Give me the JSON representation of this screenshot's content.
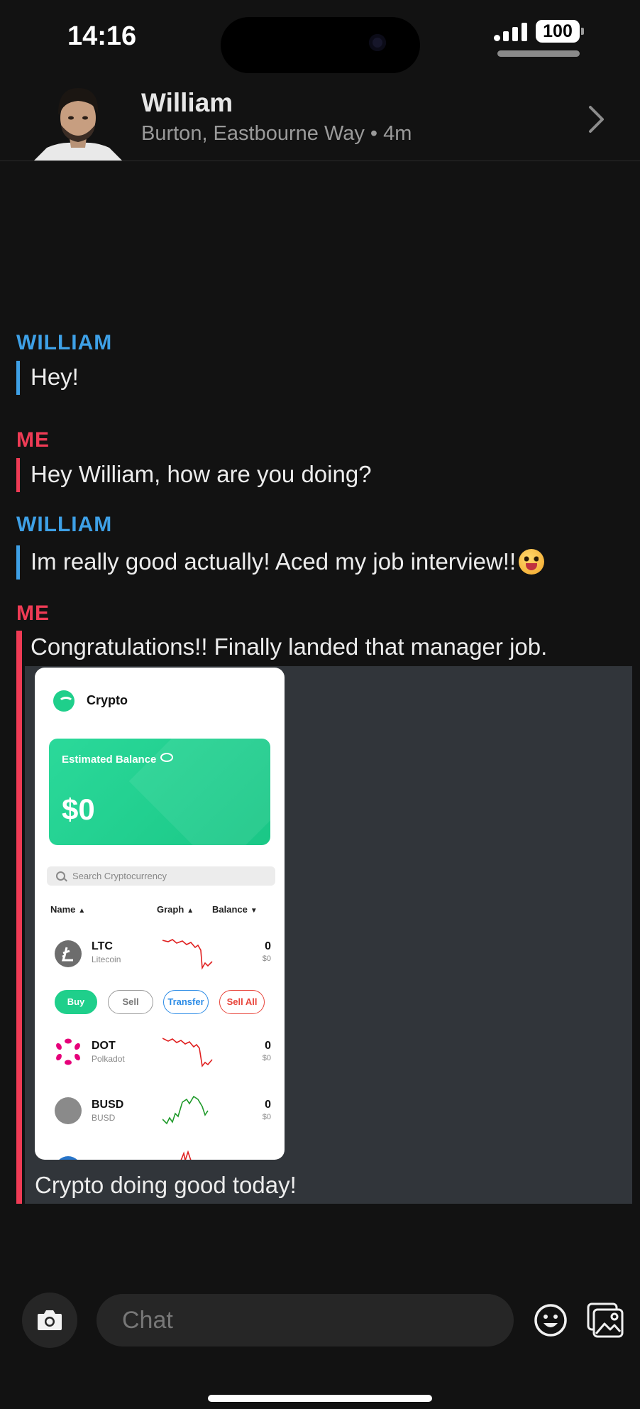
{
  "status_bar": {
    "time": "14:16",
    "battery": "100"
  },
  "contact": {
    "name": "William",
    "subtitle": "Burton, Eastbourne Way • 4m"
  },
  "messages": [
    {
      "sender": "WILLIAM",
      "text": "Hey!"
    },
    {
      "sender": "ME",
      "text": "Hey William, how are you doing?"
    },
    {
      "sender": "WILLIAM",
      "text": "Im really good actually! Aced my job interview!!"
    },
    {
      "sender": "ME",
      "text": "Congratulations!! Finally landed that manager job.",
      "attachment_caption": "Crypto doing good today!"
    }
  ],
  "attachment": {
    "app_title": "Crypto",
    "balance_label": "Estimated Balance",
    "balance_value": "$0",
    "search_placeholder": "Search Cryptocurrency",
    "columns": {
      "name": "Name",
      "graph": "Graph",
      "balance": "Balance"
    },
    "coins": [
      {
        "symbol": "LTC",
        "name": "Litecoin",
        "amount": "0",
        "usd": "$0",
        "color": "#6d6d6d",
        "trend": "down"
      },
      {
        "symbol": "DOT",
        "name": "Polkadot",
        "amount": "0",
        "usd": "$0",
        "color": "#e6007a",
        "trend": "down"
      },
      {
        "symbol": "BUSD",
        "name": "BUSD",
        "amount": "0",
        "usd": "$0",
        "color": "#8a8a8a",
        "trend": "up"
      }
    ],
    "actions": {
      "buy": "Buy",
      "sell": "Sell",
      "transfer": "Transfer",
      "sell_all": "Sell All"
    },
    "colors": {
      "accent": "#1fcf8b",
      "down": "#e02020",
      "up": "#1f9a2a",
      "transfer": "#2b8be6",
      "sell_all": "#e8443a"
    }
  },
  "composer": {
    "placeholder": "Chat"
  },
  "colors": {
    "william": "#3ea0e6",
    "me": "#ef3b55",
    "background": "#121212"
  }
}
